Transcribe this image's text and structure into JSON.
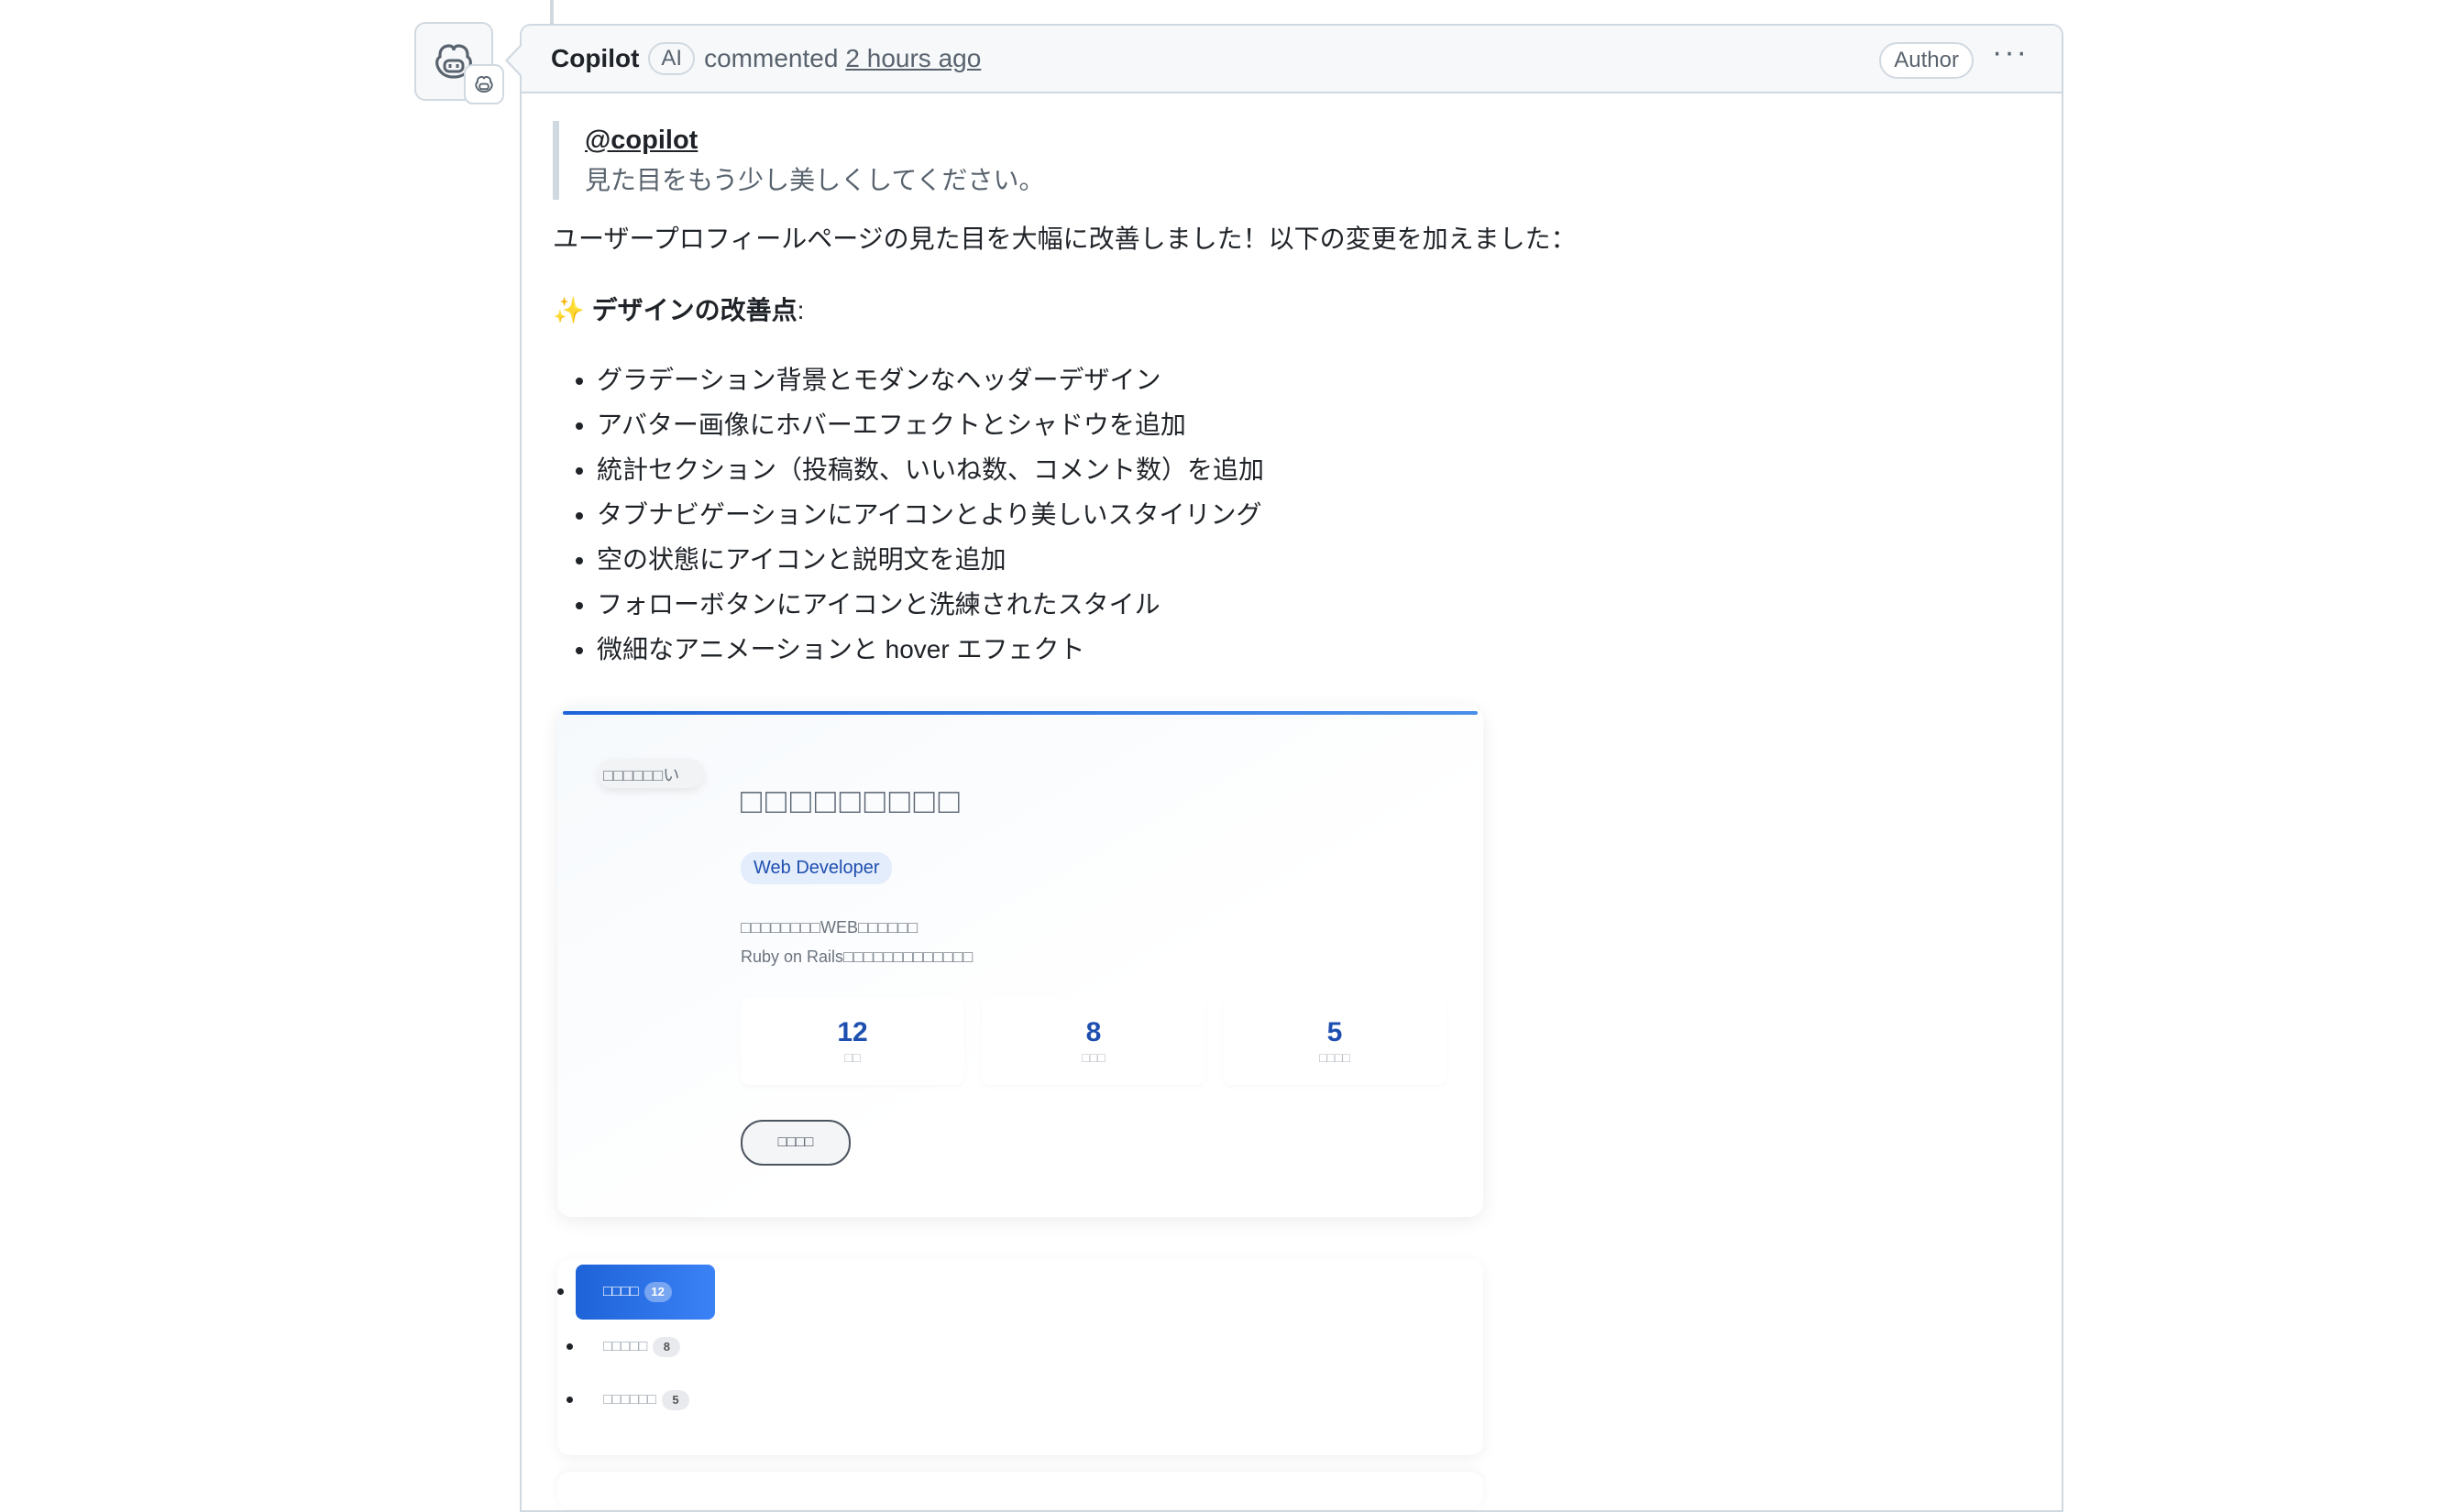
{
  "comment": {
    "author": "Copilot",
    "ai_badge": "AI",
    "action": "commented",
    "time": "2 hours ago",
    "author_badge": "Author",
    "more_label": "···"
  },
  "quote": {
    "mention": "@copilot",
    "text": "見た目をもう少し美しくしてください。"
  },
  "body": {
    "intro": "ユーザープロフィールページの見た目を大幅に改善しました！以下の変更を加えました：",
    "sparkle": "✨",
    "subhead": "デザインの改善点",
    "subhead_suffix": ":",
    "items": [
      "グラデーション背景とモダンなヘッダーデザイン",
      "アバター画像にホバーエフェクトとシャドウを追加",
      "統計セクション（投稿数、いいね数、コメント数）を追加",
      "タブナビゲーションにアイコンとより美しいスタイリング",
      "空の状態にアイコンと説明文を追加",
      "フォローボタンにアイコンと洗練されたスタイル",
      "微細なアニメーションと hover エフェクト"
    ]
  },
  "preview": {
    "avatar_alt": "□□□□□□い",
    "name": "□□□□□□□□□",
    "role": "Web Developer",
    "bio_line1": "□□□□□□□□WEB□□□□□□",
    "bio_line2": "Ruby on Rails□□□□□□□□□□□□□",
    "stats": [
      {
        "value": "12",
        "label": "□□"
      },
      {
        "value": "8",
        "label": "□□□"
      },
      {
        "value": "5",
        "label": "□□□□"
      }
    ],
    "follow_label": "□□□□",
    "tabs": [
      {
        "label": "□□□□",
        "count": "12"
      },
      {
        "label": "□□□□□",
        "count": "8"
      },
      {
        "label": "□□□□□□",
        "count": "5"
      }
    ]
  }
}
